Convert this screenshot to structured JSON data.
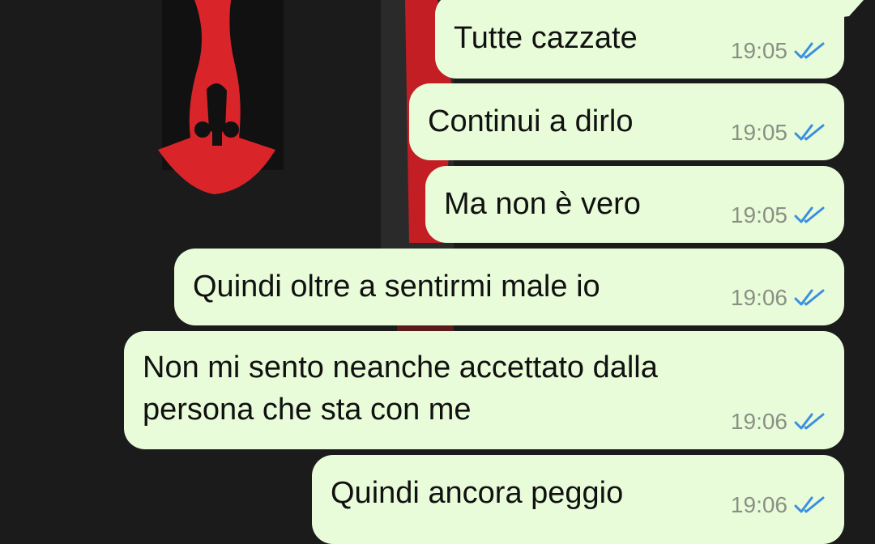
{
  "colors": {
    "background": "#1b1b1b",
    "bubble": "#e8fcd9",
    "wallpaper_accent": "#d9242a",
    "read_ticks": "#3b8fe0",
    "time_text": "#8a9184"
  },
  "messages": [
    {
      "text": "Tutte cazzate",
      "time": "19:05",
      "status_icon": "double-check-read-icon"
    },
    {
      "text": "Continui a dirlo",
      "time": "19:05",
      "status_icon": "double-check-read-icon"
    },
    {
      "text": "Ma non è vero",
      "time": "19:05",
      "status_icon": "double-check-read-icon"
    },
    {
      "text": "Quindi oltre a sentirmi male io",
      "time": "19:06",
      "status_icon": "double-check-read-icon"
    },
    {
      "text_line1": "Non mi sento neanche accettato dalla",
      "text_line2": "persona che sta con me",
      "time": "19:06",
      "status_icon": "double-check-read-icon"
    },
    {
      "text": "Quindi ancora peggio",
      "time": "19:06",
      "status_icon": "double-check-read-icon"
    }
  ]
}
